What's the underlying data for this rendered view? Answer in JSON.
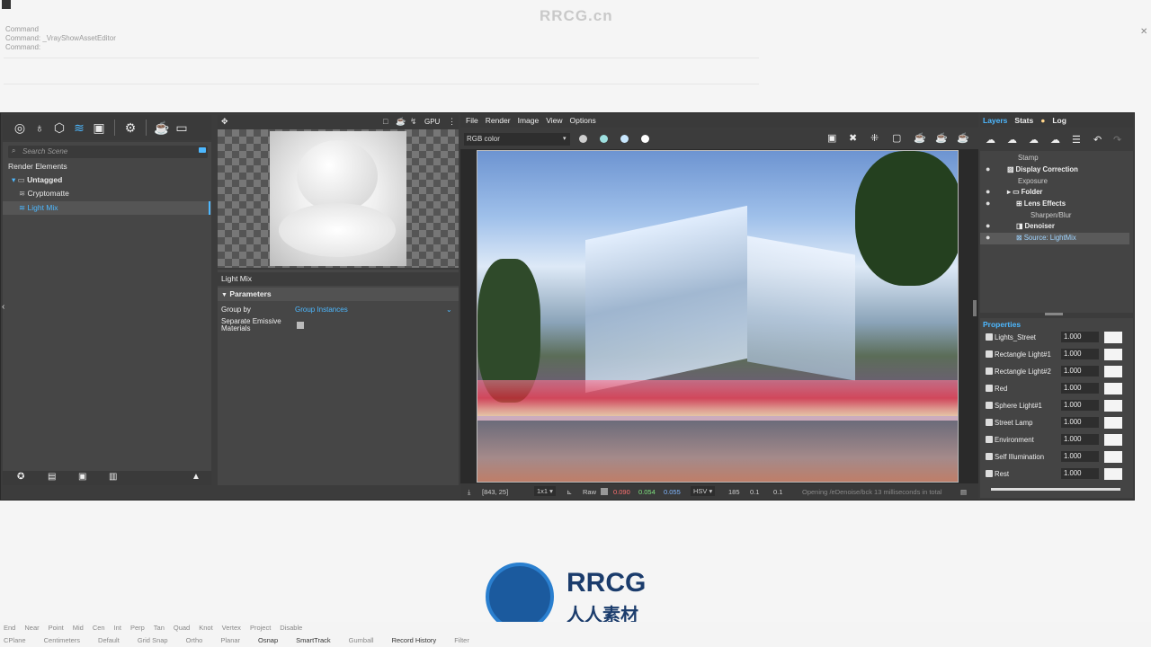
{
  "watermark": "RRCG.cn",
  "logo": {
    "title": "RRCG",
    "subtitle": "人人素材"
  },
  "command_lines": [
    "Command",
    "Command: _VrayShowAssetEditor",
    "Command:"
  ],
  "left_panel": {
    "search_placeholder": "Search Scene",
    "tree_title": "Render Elements",
    "group": "Untagged",
    "items": [
      "Cryptomatte",
      "Light Mix"
    ]
  },
  "preview_bar": {
    "gpu_label": "GPU"
  },
  "properties": {
    "title": "Light Mix",
    "section": "Parameters",
    "group_by_label": "Group by",
    "group_by_value": "Group Instances",
    "separate_emissive_label": "Separate Emissive Materials"
  },
  "vfb": {
    "menu": [
      "File",
      "Render",
      "Image",
      "View",
      "Options"
    ],
    "channel": "RGB color",
    "status": {
      "coords": "[843, 25]",
      "zoom": "1x1",
      "raw": "Raw",
      "r": "0.090",
      "g": "0.054",
      "b": "0.055",
      "mode": "HSV",
      "h": "185",
      "s": "0.1",
      "v": "0.1",
      "message": "Opening /eDenoise/bck 13 milliseconds in total"
    }
  },
  "layers_panel": {
    "tabs": [
      "Layers",
      "Stats",
      "Log"
    ],
    "layers": [
      "Stamp",
      "Display Correction",
      "Exposure",
      "Folder",
      "Lens Effects",
      "Sharpen/Blur",
      "Denoiser",
      "Source: LightMix"
    ],
    "properties_title": "Properties",
    "lights": [
      {
        "name": "Lights_Street",
        "value": "1.000"
      },
      {
        "name": "Rectangle Light#1",
        "value": "1.000"
      },
      {
        "name": "Rectangle Light#2",
        "value": "1.000"
      },
      {
        "name": "Red",
        "value": "1.000"
      },
      {
        "name": "Sphere Light#1",
        "value": "1.000"
      },
      {
        "name": "Street Lamp",
        "value": "1.000"
      },
      {
        "name": "Environment",
        "value": "1.000"
      },
      {
        "name": "Self Illumination",
        "value": "1.000"
      },
      {
        "name": "Rest",
        "value": "1.000"
      }
    ]
  },
  "bottom": {
    "snaps": [
      "End",
      "Near",
      "Point",
      "Mid",
      "Cen",
      "Int",
      "Perp",
      "Tan",
      "Quad",
      "Knot",
      "Vertex",
      "Project",
      "Disable"
    ],
    "status": [
      "CPlane",
      "Centimeters",
      "Default",
      "Grid Snap",
      "Ortho",
      "Planar",
      "Osnap",
      "SmartTrack",
      "Gumball",
      "Record History",
      "Filter"
    ]
  }
}
